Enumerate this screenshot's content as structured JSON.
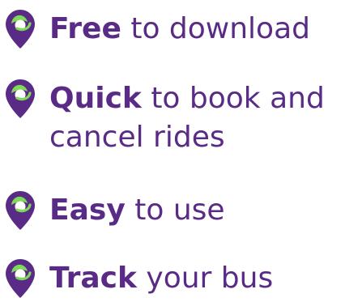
{
  "features": [
    {
      "strong": "Free",
      "rest": "to download"
    },
    {
      "strong": "Quick",
      "rest": "to book and",
      "rest_line2": "cancel rides"
    },
    {
      "strong": "Easy",
      "rest": "to use"
    },
    {
      "strong": "Track",
      "rest": "your bus"
    }
  ],
  "colors": {
    "text_purple": "#5a2b86",
    "pin_purple": "#5a2b86",
    "pin_green": "#7ed957"
  },
  "icons": {
    "bullet_icon": "location-pin-icon"
  }
}
